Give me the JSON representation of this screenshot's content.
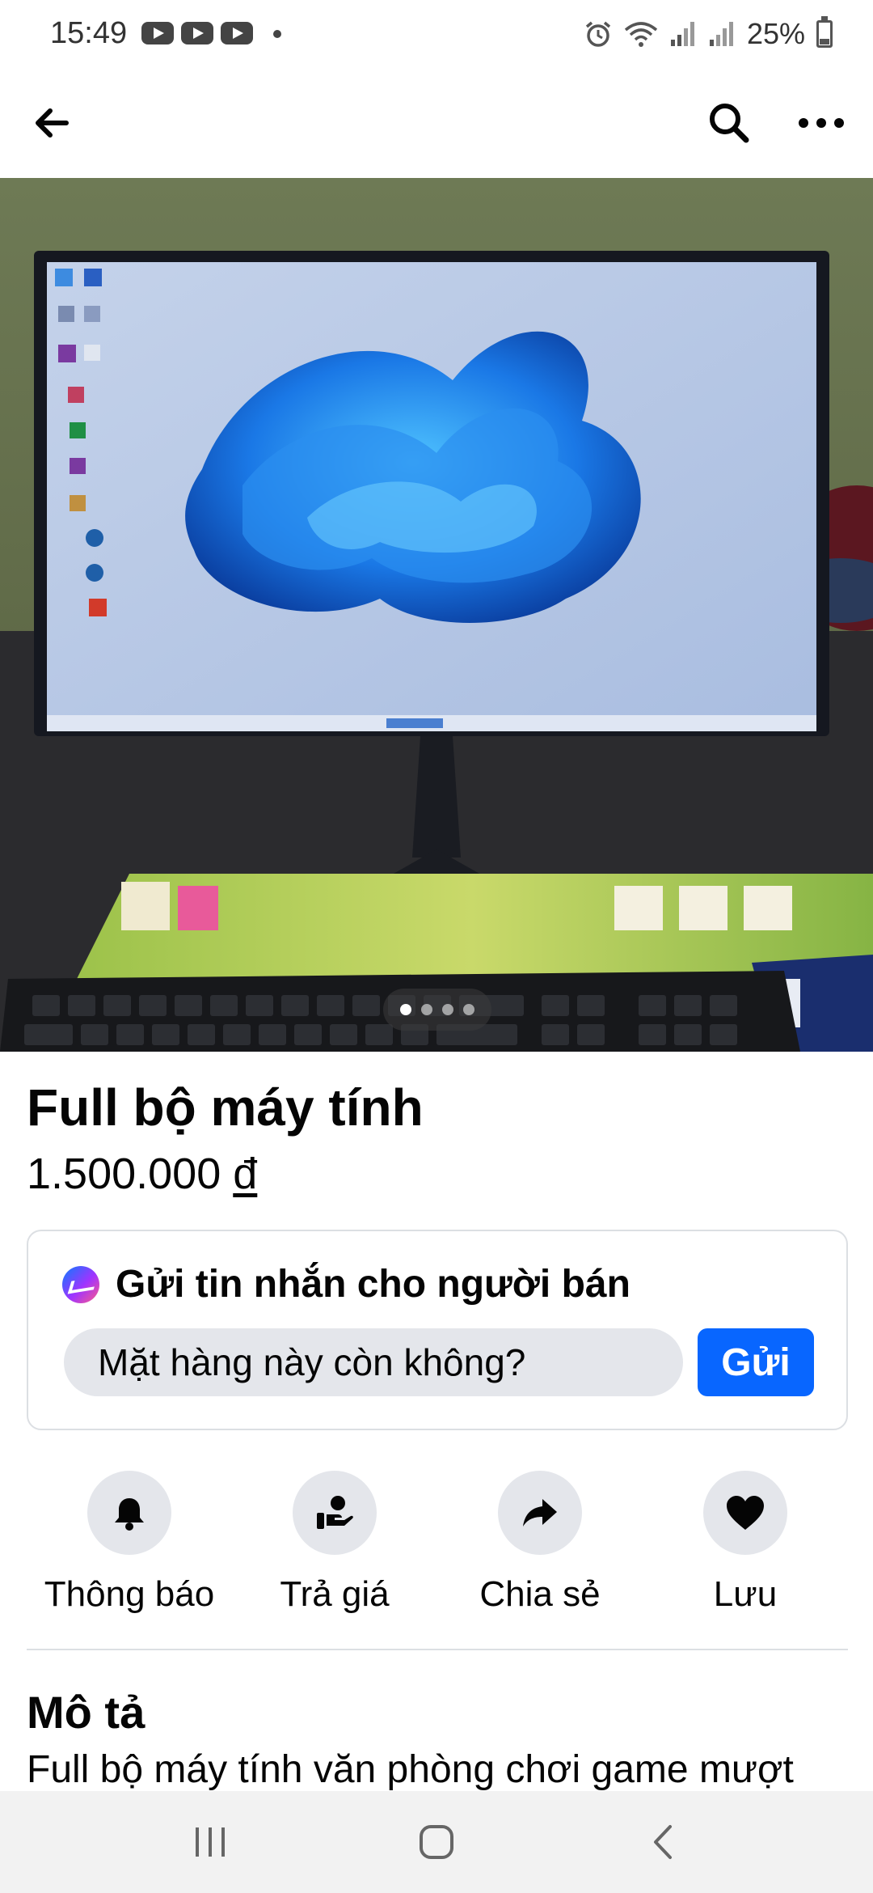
{
  "status_bar": {
    "time": "15:49",
    "battery": "25%",
    "notification_icons": [
      "youtube-icon",
      "youtube-icon",
      "youtube-icon"
    ],
    "system_icons": [
      "alarm-icon",
      "wifi-icon",
      "signal-icon",
      "signal-icon",
      "battery-icon"
    ]
  },
  "app_bar": {
    "back_icon": "arrow-left-icon",
    "search_icon": "search-icon",
    "more_icon": "more-horizontal-icon"
  },
  "gallery": {
    "image_count": 4,
    "active_index": 0
  },
  "listing": {
    "title": "Full bộ máy tính",
    "price": "1.500.000",
    "currency": "đ"
  },
  "message": {
    "heading": "Gửi tin nhắn cho người bán",
    "input_value": "Mặt hàng này còn không?",
    "send_label": "Gửi"
  },
  "actions": [
    {
      "label": "Thông báo",
      "icon": "bell-icon"
    },
    {
      "label": "Trả giá",
      "icon": "offer-hand-icon"
    },
    {
      "label": "Chia sẻ",
      "icon": "share-icon"
    },
    {
      "label": "Lưu",
      "icon": "heart-icon"
    }
  ],
  "description": {
    "title": "Mô tả",
    "text": "Full bộ máy tính văn phòng chơi game mượt"
  },
  "colors": {
    "accent": "#0866ff",
    "chip_bg": "#e4e6eb",
    "text": "#050505"
  }
}
